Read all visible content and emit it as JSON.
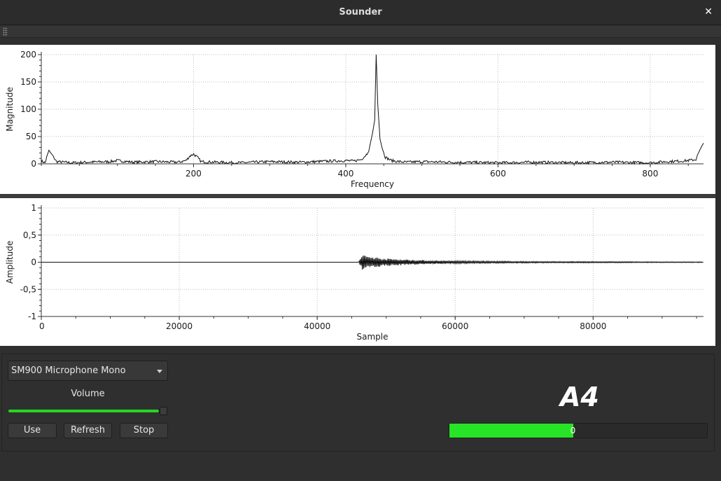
{
  "window": {
    "title": "Sounder",
    "close_glyph": "✕",
    "close_icon": "close-icon",
    "grip_icon": "toolbar-grip-icon"
  },
  "chart_data": [
    {
      "type": "line",
      "xlabel": "Frequency",
      "ylabel": "Magnitude",
      "xlim": [
        0,
        870
      ],
      "ylim": [
        0,
        200
      ],
      "x_ticks": [
        200,
        400,
        600,
        800
      ],
      "y_ticks": [
        0,
        50,
        100,
        150,
        200
      ],
      "grid": true,
      "series": [
        {
          "x": [
            0,
            5,
            10,
            20,
            40,
            60,
            90,
            100,
            120,
            150,
            180,
            190,
            195,
            200,
            205,
            210,
            230,
            260,
            300,
            340,
            380,
            400,
            410,
            420,
            425,
            430,
            435,
            438,
            440,
            442,
            445,
            448,
            452,
            460,
            470,
            480,
            500,
            540,
            600,
            650,
            700,
            750,
            800,
            820,
            840,
            850,
            860,
            865,
            870
          ],
          "y": [
            5,
            2,
            25,
            4,
            2,
            3,
            4,
            6,
            3,
            4,
            3,
            6,
            14,
            18,
            12,
            4,
            3,
            2,
            4,
            3,
            5,
            6,
            5,
            8,
            14,
            22,
            55,
            80,
            200,
            110,
            45,
            28,
            12,
            6,
            4,
            3,
            4,
            3,
            2,
            3,
            2,
            3,
            2,
            4,
            5,
            6,
            8,
            25,
            38
          ]
        }
      ]
    },
    {
      "type": "line",
      "xlabel": "Sample",
      "ylabel": "Amplitude",
      "xlim": [
        0,
        96000
      ],
      "ylim": [
        -1,
        1
      ],
      "x_ticks": [
        0,
        20000,
        40000,
        60000,
        80000
      ],
      "y_ticks": [
        "1",
        "0,5",
        "0",
        "-0,5",
        "-1"
      ],
      "y_tick_values": [
        1,
        0.5,
        0,
        -0.5,
        -1
      ],
      "grid": true,
      "series": [
        {
          "envelope_x": [
            0,
            46000,
            46500,
            48000,
            50000,
            53000,
            56000,
            60000,
            65000,
            70000,
            75000,
            80000,
            85000,
            90000,
            96000
          ],
          "envelope_amp": [
            0.0,
            0.0,
            0.14,
            0.1,
            0.07,
            0.05,
            0.035,
            0.025,
            0.018,
            0.014,
            0.012,
            0.012,
            0.01,
            0.008,
            0.006
          ]
        }
      ]
    }
  ],
  "controls": {
    "device": "SM900 Microphone  Mono",
    "volume_label": "Volume",
    "volume_value": 0.97,
    "use_label": "Use",
    "refresh_label": "Refresh",
    "stop_label": "Stop"
  },
  "result": {
    "note": "A4",
    "progress_value": 0.48,
    "progress_text": "0",
    "progress_color": "#27e526",
    "slider_color": "#23d820"
  }
}
